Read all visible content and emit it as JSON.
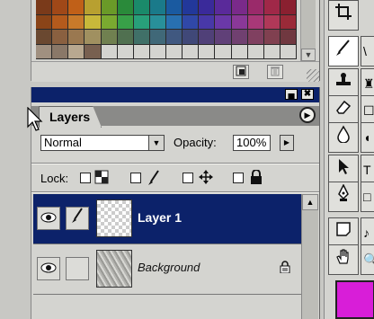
{
  "swatches": {
    "colors": [
      "#7a3a1a",
      "#a04818",
      "#c06018",
      "#b8a030",
      "#6a9a28",
      "#2a8a3a",
      "#1a8a6a",
      "#1a7a8a",
      "#1a5aa0",
      "#22389a",
      "#3a2a9a",
      "#5a2a9a",
      "#7a2a8a",
      "#9a2a6a",
      "#a02848",
      "#8a2030",
      "#8a4418",
      "#b45a1c",
      "#c87a2a",
      "#c8b83a",
      "#7aaa30",
      "#38a048",
      "#28a07a",
      "#28909a",
      "#2870b0",
      "#3048a8",
      "#4838a8",
      "#6a38a8",
      "#8a3898",
      "#a83878",
      "#b03858",
      "#9a2a38",
      "#6a4830",
      "#8a6040",
      "#9a7850",
      "#a09060",
      "#708050",
      "#507050",
      "#407068",
      "#406878",
      "#405880",
      "#404878",
      "#504078",
      "#604078",
      "#704070",
      "#804060",
      "#804050",
      "#703840",
      "#a09080",
      "#8a7868",
      "#b8a890",
      "#786050",
      "#d4d4d0",
      "#d4d4d0",
      "#d4d4d0",
      "#d4d4d0",
      "#d4d4d0",
      "#d4d4d0",
      "#d4d4d0",
      "#d4d4d0",
      "#d4d4d0",
      "#d4d4d0",
      "#d4d4d0",
      "#d4d4d0"
    ],
    "new_icon": "new-swatch-icon",
    "delete_icon": "trash-icon"
  },
  "window": {
    "minimize_glyph": "▄",
    "close_glyph": "✖"
  },
  "layers": {
    "tab_label": "Layers",
    "menu_glyph": "▶",
    "blend_mode": "Normal",
    "opacity_label": "Opacity:",
    "opacity_value": "100%",
    "lock_label": "Lock:",
    "rows": [
      {
        "name": "Layer 1",
        "selected": true,
        "brush": true
      },
      {
        "name": "Background",
        "selected": false,
        "locked": true
      }
    ]
  },
  "tools": {
    "icons": [
      "crop-icon",
      "pencil-icon",
      "stamp-icon",
      "eraser-icon",
      "blur-drop-icon",
      "arrow-select-icon",
      "pen-tool-icon",
      "notes-icon",
      "hand-icon"
    ],
    "foreground_color": "#d81ed8"
  }
}
